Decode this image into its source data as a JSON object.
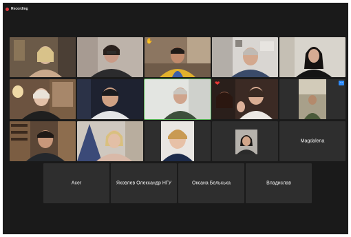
{
  "recording": {
    "label": "Recording",
    "color": "#e0393e"
  },
  "colors": {
    "background": "#1a1a1a",
    "tile": "#2e2e2e",
    "active_speaker": "#52b552",
    "accent": "#2d8cff"
  },
  "video_tiles": [
    {
      "id": "r1c1",
      "icon": "person-video"
    },
    {
      "id": "r1c2",
      "icon": "person-video"
    },
    {
      "id": "r1c3",
      "icon": "person-video",
      "reaction": "hand-icon"
    },
    {
      "id": "r1c4",
      "icon": "person-video"
    },
    {
      "id": "r1c5",
      "icon": "person-video"
    },
    {
      "id": "r2c1",
      "icon": "person-video"
    },
    {
      "id": "r2c2",
      "icon": "person-video"
    },
    {
      "id": "r2c3",
      "icon": "person-video",
      "active_speaker": true
    },
    {
      "id": "r2c4",
      "icon": "person-video",
      "reaction": "heart-icon"
    },
    {
      "id": "r2c5",
      "icon": "person-video",
      "menu_button": "more-options-icon"
    },
    {
      "id": "r3c1",
      "icon": "person-video"
    },
    {
      "id": "r3c2",
      "icon": "person-video"
    },
    {
      "id": "r3c3",
      "icon": "person-video"
    },
    {
      "id": "r3c4",
      "icon": "profile-photo"
    }
  ],
  "name_tiles": [
    {
      "name": "Magdalena"
    },
    {
      "name": "Acer"
    },
    {
      "name": "Яковлев Олександр НГУ"
    },
    {
      "name": "Оксана Бельська"
    },
    {
      "name": "Владислав"
    }
  ]
}
